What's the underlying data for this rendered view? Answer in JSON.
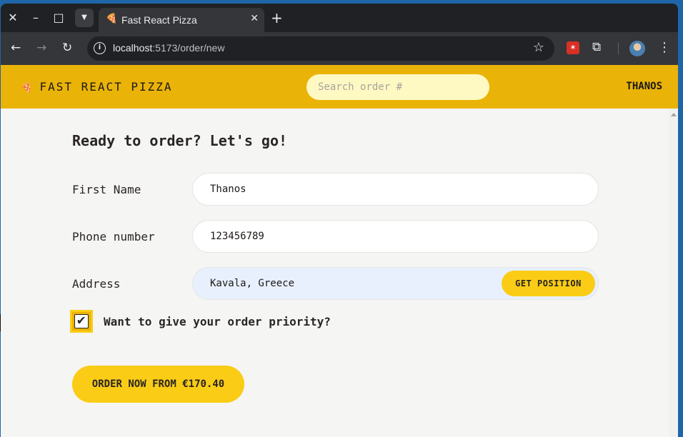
{
  "browser": {
    "window_controls": {
      "close": "✕",
      "minimize": "–",
      "maximize": "□"
    },
    "tab": {
      "title": "Fast React Pizza",
      "favicon": "🍕",
      "close": "✕"
    },
    "new_tab": "+",
    "url_host": "localhost",
    "url_path": ":5173/order/new",
    "nav": {
      "back": "←",
      "forward": "→",
      "reload": "↻"
    }
  },
  "app": {
    "logo_text": "FAST REACT PIZZA",
    "logo_icon": "🍕",
    "search_placeholder": "Search order #",
    "username": "THANOS"
  },
  "form": {
    "heading": "Ready to order? Let's go!",
    "first_name_label": "First Name",
    "first_name_value": "Thanos",
    "phone_label": "Phone number",
    "phone_value": "123456789",
    "address_label": "Address",
    "address_value": "Kavala, Greece",
    "get_position_label": "GET POSITION",
    "priority_label": "Want to give your order priority?",
    "priority_checked": true,
    "order_button_label": "ORDER NOW FROM €170.40"
  },
  "colors": {
    "header": "#eab308",
    "accent": "#facc15",
    "search_bg": "#fef9c3",
    "page_bg": "#f5f5f4"
  }
}
